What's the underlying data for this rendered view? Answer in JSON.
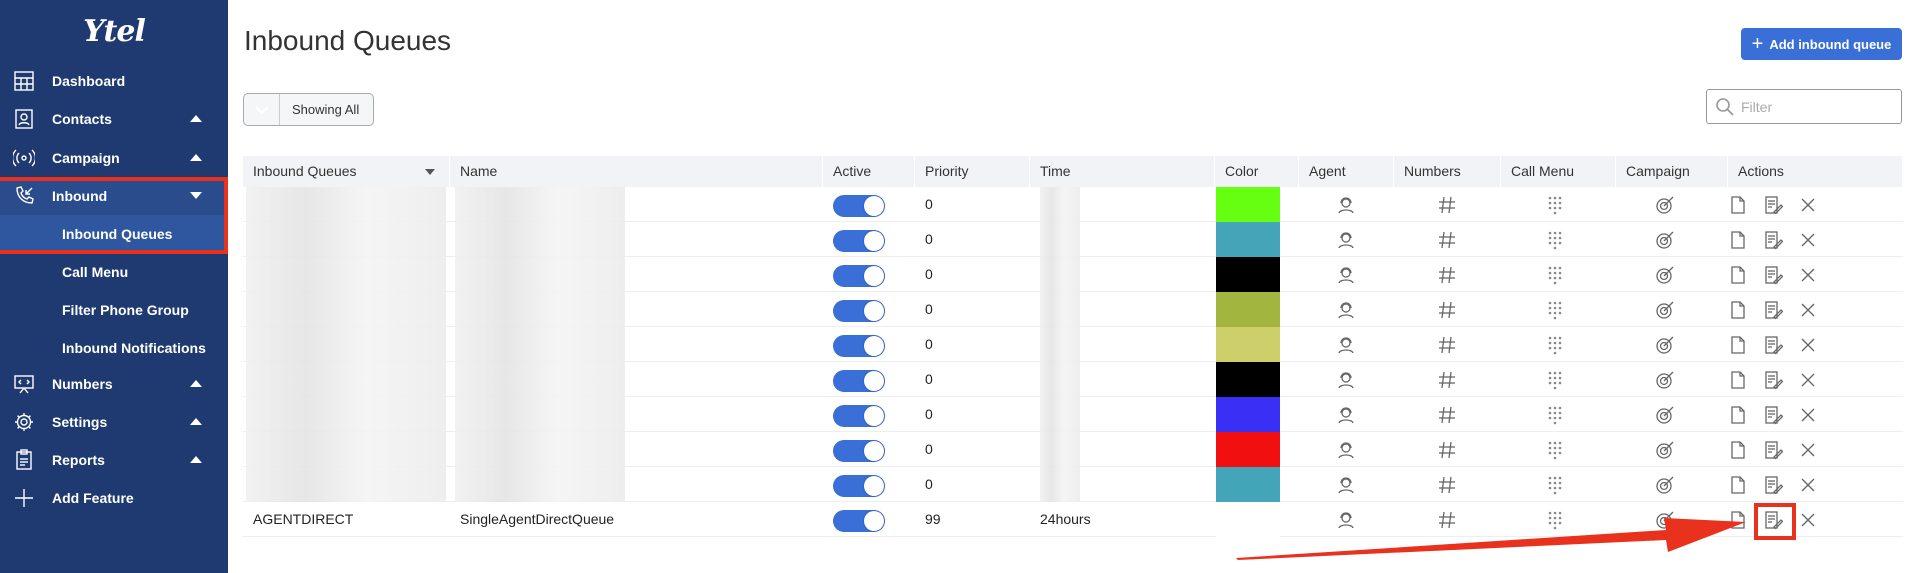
{
  "sidebar": {
    "logo": "Ytel",
    "items": [
      {
        "label": "Dashboard",
        "icon": "dashboard-icon"
      },
      {
        "label": "Contacts",
        "icon": "contacts-icon",
        "caret": "up"
      },
      {
        "label": "Campaign",
        "icon": "campaign-icon",
        "caret": "up"
      },
      {
        "label": "Inbound",
        "icon": "inbound-icon",
        "caret": "down"
      },
      {
        "label": "Numbers",
        "icon": "numbers-icon",
        "caret": "up"
      },
      {
        "label": "Settings",
        "icon": "gear-icon",
        "caret": "up"
      },
      {
        "label": "Reports",
        "icon": "reports-icon",
        "caret": "up"
      },
      {
        "label": "Add Feature",
        "icon": "plus-icon"
      }
    ],
    "subitems": [
      {
        "label": "Inbound Queues"
      },
      {
        "label": "Call Menu"
      },
      {
        "label": "Filter Phone Group"
      },
      {
        "label": "Inbound Notifications"
      }
    ]
  },
  "header": {
    "title": "Inbound Queues",
    "add_button": "Add inbound queue"
  },
  "toolbar": {
    "showing_label": "Showing All",
    "filter_placeholder": "Filter"
  },
  "table": {
    "columns": [
      "Inbound Queues",
      "Name",
      "Active",
      "Priority",
      "Time",
      "Color",
      "Agent",
      "Numbers",
      "Call Menu",
      "Campaign",
      "Actions"
    ],
    "rows": [
      {
        "queue": "",
        "name": "",
        "active": true,
        "priority": "0",
        "time": "",
        "color": "#66ff11"
      },
      {
        "queue": "",
        "name": "",
        "active": true,
        "priority": "0",
        "time": "",
        "color": "#44a4b8"
      },
      {
        "queue": "",
        "name": "",
        "active": true,
        "priority": "0",
        "time": "",
        "color": "#000000"
      },
      {
        "queue": "",
        "name": "",
        "active": true,
        "priority": "0",
        "time": "",
        "color": "#a2b53f"
      },
      {
        "queue": "",
        "name": "",
        "active": true,
        "priority": "0",
        "time": "",
        "color": "#cdd06a"
      },
      {
        "queue": "",
        "name": "",
        "active": true,
        "priority": "0",
        "time": "",
        "color": "#000000"
      },
      {
        "queue": "",
        "name": "",
        "active": true,
        "priority": "0",
        "time": "",
        "color": "#3a2ff5"
      },
      {
        "queue": "",
        "name": "",
        "active": true,
        "priority": "0",
        "time": "",
        "color": "#f10f0f"
      },
      {
        "queue": "",
        "name": "",
        "active": true,
        "priority": "0",
        "time": "",
        "color": "#44a4b8"
      },
      {
        "queue": "AGENTDIRECT",
        "name": "SingleAgentDirectQueue",
        "active": true,
        "priority": "99",
        "time": "24hours",
        "color": "#ffffff"
      }
    ]
  },
  "colors": {
    "sidebar_bg": "#1f3a70",
    "accent": "#3a6fd8",
    "annotation": "#e8321e"
  }
}
